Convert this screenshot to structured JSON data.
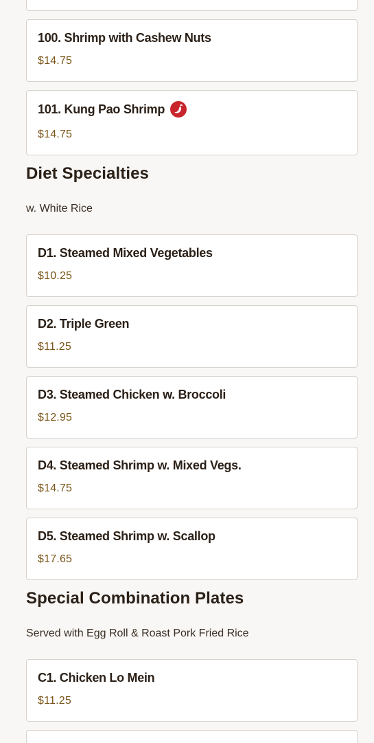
{
  "sections": [
    {
      "items": [
        {
          "name": "",
          "price": ""
        },
        {
          "name": "100. Shrimp with Cashew Nuts",
          "price": "$14.75"
        },
        {
          "name": "101. Kung Pao Shrimp",
          "price": "$14.75",
          "icon": "spicy-chili-icon"
        }
      ]
    },
    {
      "title": "Diet Specialties",
      "subtitle": "w. White Rice",
      "items": [
        {
          "name": "D1. Steamed Mixed Vegetables",
          "price": "$10.25"
        },
        {
          "name": "D2. Triple Green",
          "price": "$11.25"
        },
        {
          "name": "D3. Steamed Chicken w. Broccoli",
          "price": "$12.95"
        },
        {
          "name": "D4. Steamed Shrimp w. Mixed Vegs.",
          "price": "$14.75"
        },
        {
          "name": "D5. Steamed Shrimp w. Scallop",
          "price": "$17.65"
        }
      ]
    },
    {
      "title": "Special Combination Plates",
      "subtitle": "Served with Egg Roll & Roast Pork Fried Rice",
      "items": [
        {
          "name": "C1. Chicken Lo Mein",
          "price": "$11.25"
        },
        {
          "name": "",
          "price": ""
        }
      ]
    }
  ],
  "colors": {
    "background": "#f8f7f5",
    "card": "#ffffff",
    "border": "#d6d2ce",
    "price": "#7a5519",
    "spicy": "#c8262c"
  }
}
